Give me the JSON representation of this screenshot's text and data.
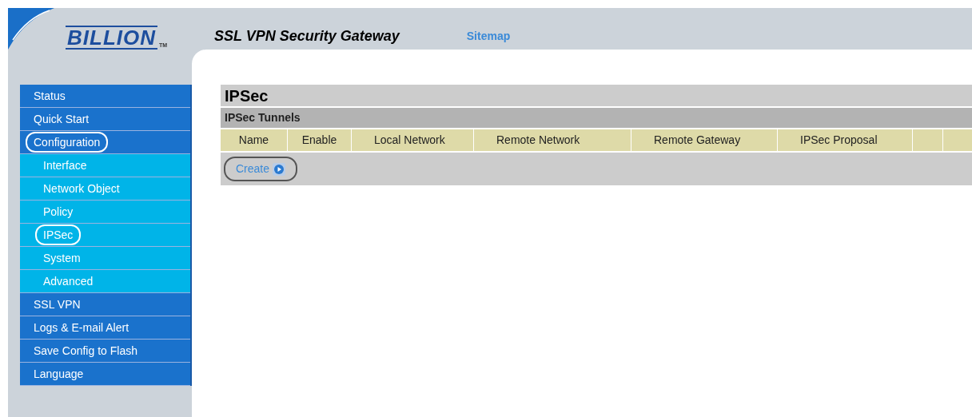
{
  "header": {
    "logo": "BILLION",
    "logo_mark": "TM",
    "title": "SSL VPN Security Gateway",
    "link": "Sitemap"
  },
  "sidebar": {
    "items": [
      {
        "label": "Status",
        "circled": false
      },
      {
        "label": "Quick Start",
        "circled": false
      },
      {
        "label": "Configuration",
        "circled": true,
        "children": [
          {
            "label": "Interface",
            "circled": false
          },
          {
            "label": "Network Object",
            "circled": false
          },
          {
            "label": "Policy",
            "circled": false
          },
          {
            "label": "IPSec",
            "circled": true
          },
          {
            "label": "System",
            "circled": false
          },
          {
            "label": "Advanced",
            "circled": false
          }
        ]
      },
      {
        "label": "SSL VPN",
        "circled": false
      },
      {
        "label": "Logs & E-mail Alert",
        "circled": false
      },
      {
        "label": "Save Config to Flash",
        "circled": false
      },
      {
        "label": "Language",
        "circled": false
      }
    ]
  },
  "content": {
    "title": "IPSec",
    "section": "IPSec Tunnels",
    "table": {
      "columns": [
        "Name",
        "Enable",
        "Local Network",
        "Remote Network",
        "Remote Gateway",
        "IPSec Proposal"
      ]
    },
    "create_button": {
      "label": "Create",
      "circled": true
    }
  }
}
